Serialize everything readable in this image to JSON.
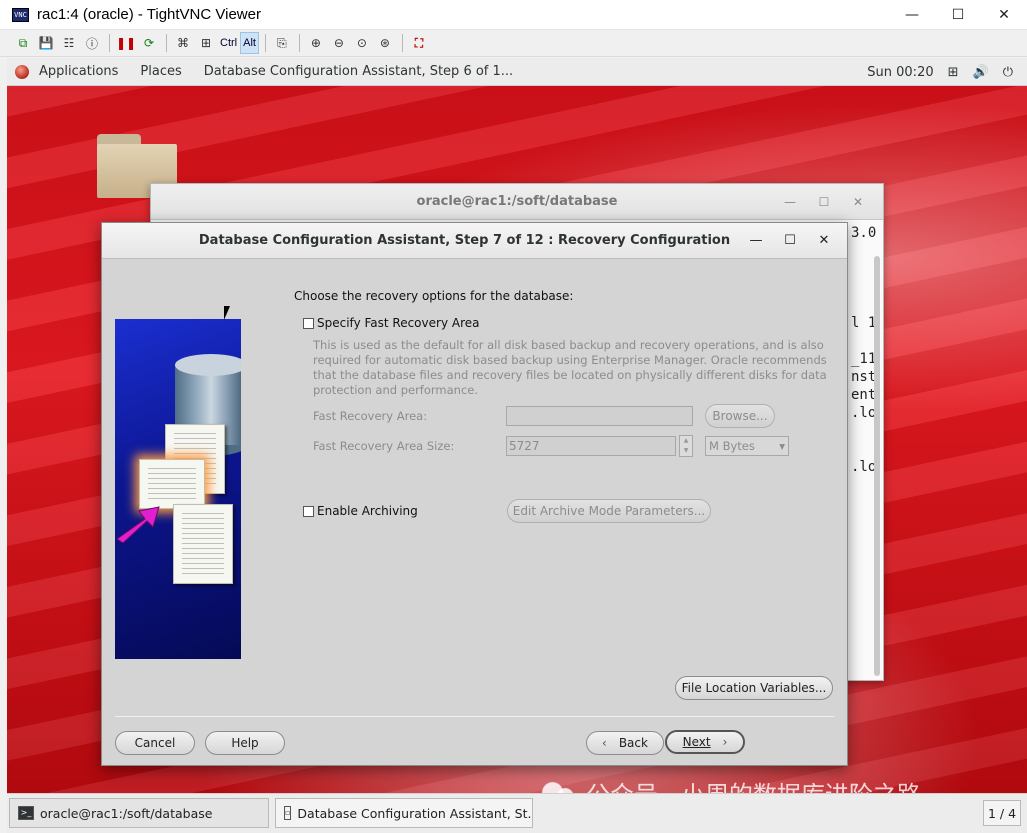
{
  "vnc": {
    "icon_text": "VNC",
    "title": "rac1:4 (oracle) - TightVNC Viewer",
    "toolbar": {
      "ctrl": "Ctrl",
      "alt": "Alt"
    },
    "window_controls": {
      "minimize": "—",
      "maximize": "☐",
      "close": "✕"
    }
  },
  "gnome": {
    "applications": "Applications",
    "places": "Places",
    "active_window": "Database Configuration Assistant, Step 6 of 1...",
    "clock": "Sun 00:20"
  },
  "terminal": {
    "title": "oracle@rac1:/soft/database",
    "lines": "3.0\n\n\n\n\nl 1\n\n_11\nnst\nent\n.lo\n\n\n.lo"
  },
  "dialog": {
    "title": "Database Configuration Assistant, Step 7 of 12 : Recovery Configuration",
    "prompt": "Choose the recovery options for the database:",
    "fra_checkbox": "Specify Fast Recovery Area",
    "fra_description": "This is used as the default for all disk based backup and recovery operations, and is also required for automatic disk based backup using Enterprise Manager. Oracle recommends that the database files and recovery files be located on physically different disks for data protection and performance.",
    "fra_label": "Fast Recovery Area:",
    "fra_value": "",
    "browse": "Browse...",
    "fra_size_label": "Fast Recovery Area Size:",
    "fra_size_value": "5727",
    "fra_size_unit": "M Bytes",
    "archiving_checkbox": "Enable Archiving",
    "archive_params": "Edit Archive Mode Parameters...",
    "file_location": "File Location Variables...",
    "cancel": "Cancel",
    "help": "Help",
    "back": "Back",
    "next": "Next",
    "checkboxes": {
      "fra_checked": false,
      "archiving_checked": false
    }
  },
  "taskbar": {
    "tasks": [
      {
        "label": "oracle@rac1:/soft/database"
      },
      {
        "label": "Database Configuration Assistant, St..."
      }
    ],
    "watermark": "公众号 · 小周的数据库进阶之路",
    "page": "1 / 4"
  }
}
